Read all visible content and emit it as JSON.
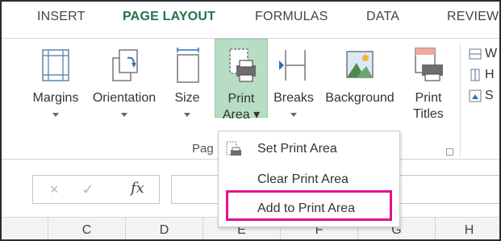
{
  "tabs": [
    "INSERT",
    "PAGE LAYOUT",
    "FORMULAS",
    "DATA",
    "REVIEW"
  ],
  "active_tab": "PAGE LAYOUT",
  "ribbon": {
    "margins": "Margins",
    "orientation": "Orientation",
    "size": "Size",
    "print_area_line1": "Print",
    "print_area_line2": "Area",
    "breaks": "Breaks",
    "background": "Background",
    "print_titles_line1": "Print",
    "print_titles_line2": "Titles",
    "group_label": "Pag",
    "side_items": [
      "W",
      "H",
      "S"
    ]
  },
  "menu": {
    "set_print_area": "Set Print Area",
    "clear_print_area": "Clear Print Area",
    "add_to_print_area": "Add to Print Area"
  },
  "formula_bar": {
    "cancel": "×",
    "enter": "✓",
    "fx": "fx"
  },
  "columns": [
    "C",
    "D",
    "E",
    "F",
    "G",
    "H"
  ],
  "colors": {
    "accent": "#217346",
    "highlight": "#e0148e",
    "selected_button": "#b8ddc5"
  }
}
